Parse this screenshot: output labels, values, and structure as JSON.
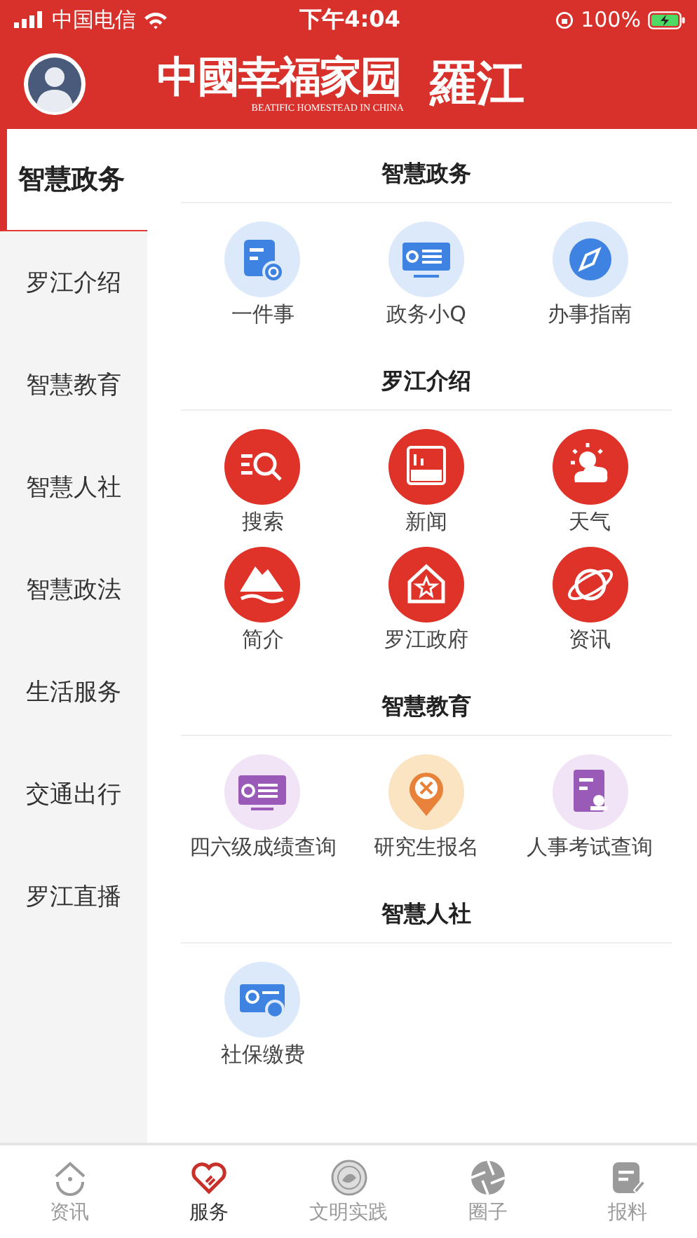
{
  "status_bar": {
    "carrier": "中国电信",
    "time": "下午4:04",
    "battery": "100%"
  },
  "header": {
    "logo_main": "中國幸福家园",
    "logo_sub": "BEATIFIC HOMESTEAD IN CHINA",
    "logo_place": "羅江"
  },
  "sidebar": {
    "items": [
      {
        "label": "智慧政务",
        "selected": true
      },
      {
        "label": "罗江介绍",
        "selected": false
      },
      {
        "label": "智慧教育",
        "selected": false
      },
      {
        "label": "智慧人社",
        "selected": false
      },
      {
        "label": "智慧政法",
        "selected": false
      },
      {
        "label": "生活服务",
        "selected": false
      },
      {
        "label": "交通出行",
        "selected": false
      },
      {
        "label": "罗江直播",
        "selected": false
      }
    ]
  },
  "sections": [
    {
      "title": "智慧政务",
      "items": [
        {
          "label": "一件事"
        },
        {
          "label": "政务小Q"
        },
        {
          "label": "办事指南"
        }
      ]
    },
    {
      "title": "罗江介绍",
      "items": [
        {
          "label": "搜索"
        },
        {
          "label": "新闻"
        },
        {
          "label": "天气"
        },
        {
          "label": "简介"
        },
        {
          "label": "罗江政府"
        },
        {
          "label": "资讯"
        }
      ]
    },
    {
      "title": "智慧教育",
      "items": [
        {
          "label": "四六级成绩查询"
        },
        {
          "label": "研究生报名"
        },
        {
          "label": "人事考试查询"
        }
      ]
    },
    {
      "title": "智慧人社",
      "items": [
        {
          "label": "社保缴费"
        }
      ]
    }
  ],
  "tab_bar": {
    "items": [
      {
        "label": "资讯",
        "selected": false
      },
      {
        "label": "服务",
        "selected": true
      },
      {
        "label": "文明实践",
        "selected": false
      },
      {
        "label": "圈子",
        "selected": false
      },
      {
        "label": "报料",
        "selected": false
      }
    ]
  }
}
